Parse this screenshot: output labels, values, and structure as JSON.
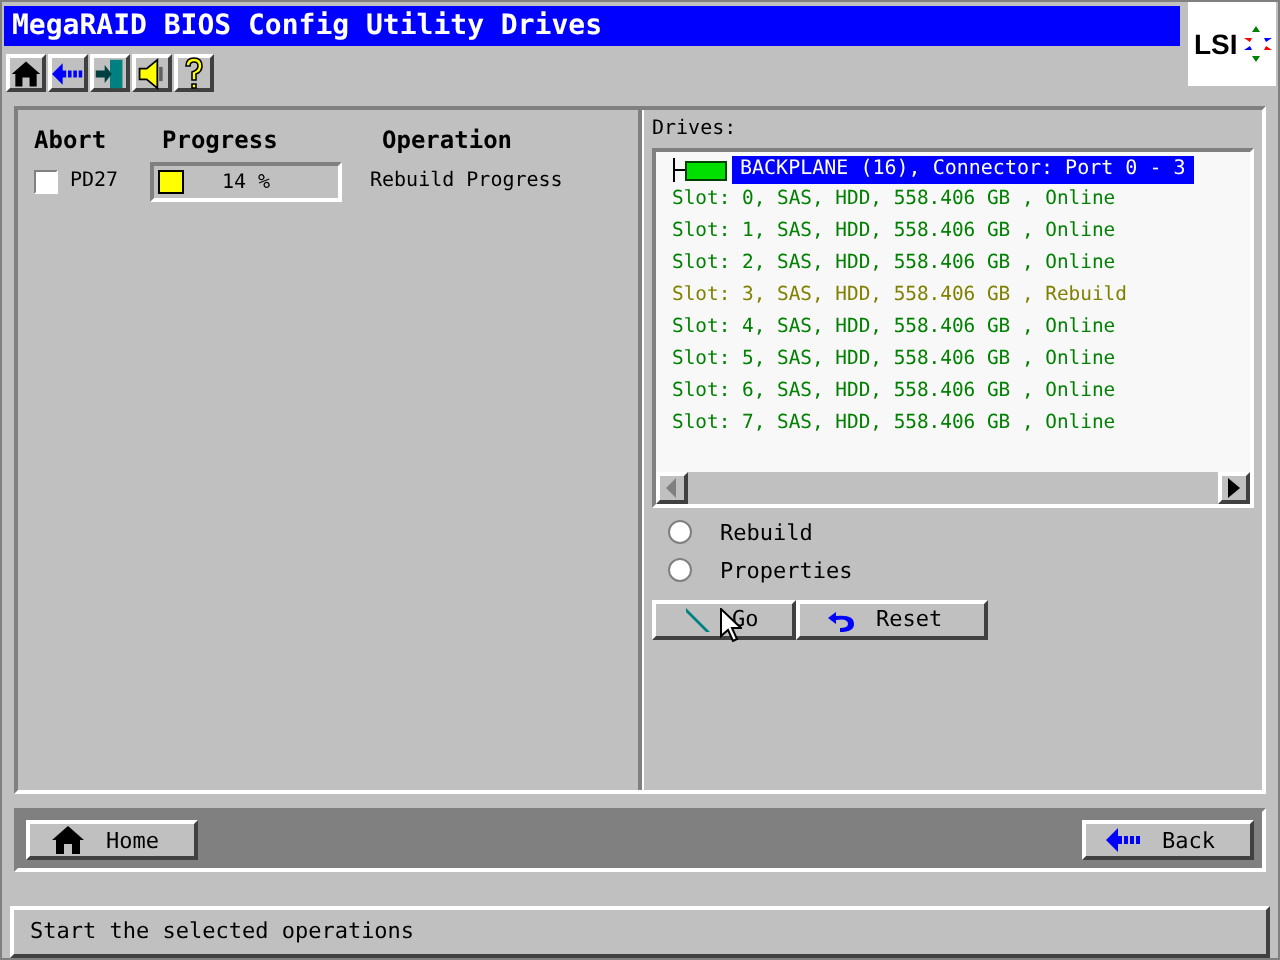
{
  "window": {
    "title": "MegaRAID BIOS Config Utility Drives",
    "logo": "LSI"
  },
  "toolbar": [
    {
      "kind": "home"
    },
    {
      "kind": "back"
    },
    {
      "kind": "exit"
    },
    {
      "kind": "sound"
    },
    {
      "kind": "help"
    }
  ],
  "operations": {
    "columns": [
      "Abort",
      "Progress",
      "Operation"
    ],
    "rows": [
      {
        "drive": "PD27",
        "checked": false,
        "level": 0.14,
        "reading": "14 %",
        "operation": "Rebuild Progress"
      }
    ]
  },
  "drives": {
    "label": "Drives:",
    "root": {
      "label": "BACKPLANE (16), Connector: Port 0 - 3",
      "selected": true
    },
    "items": [
      {
        "label": "Slot: 0, SAS, HDD, 558.406 GB , Online",
        "color": "#008000"
      },
      {
        "label": "Slot: 1, SAS, HDD, 558.406 GB , Online",
        "color": "#008000"
      },
      {
        "label": "Slot: 2, SAS, HDD, 558.406 GB , Online",
        "color": "#008000"
      },
      {
        "label": "Slot: 3, SAS, HDD, 558.406 GB , Rebuild",
        "color": "#808000"
      },
      {
        "label": "Slot: 4, SAS, HDD, 558.406 GB , Online",
        "color": "#008000"
      },
      {
        "label": "Slot: 5, SAS, HDD, 558.406 GB , Online",
        "color": "#008000"
      },
      {
        "label": "Slot: 6, SAS, HDD, 558.406 GB , Online",
        "color": "#008000"
      },
      {
        "label": "Slot: 7, SAS, HDD, 558.406 GB , Online",
        "color": "#008000"
      }
    ],
    "options": [
      {
        "label": "Rebuild",
        "selected": false
      },
      {
        "label": "Properties",
        "selected": false
      }
    ],
    "buttons": [
      {
        "kind": "go",
        "label": "Go"
      },
      {
        "kind": "reset",
        "label": "Reset"
      }
    ]
  },
  "nav": [
    {
      "kind": "home",
      "label": "Home"
    },
    {
      "kind": "back",
      "label": "Back"
    }
  ],
  "status_bar": "Start the selected operations"
}
